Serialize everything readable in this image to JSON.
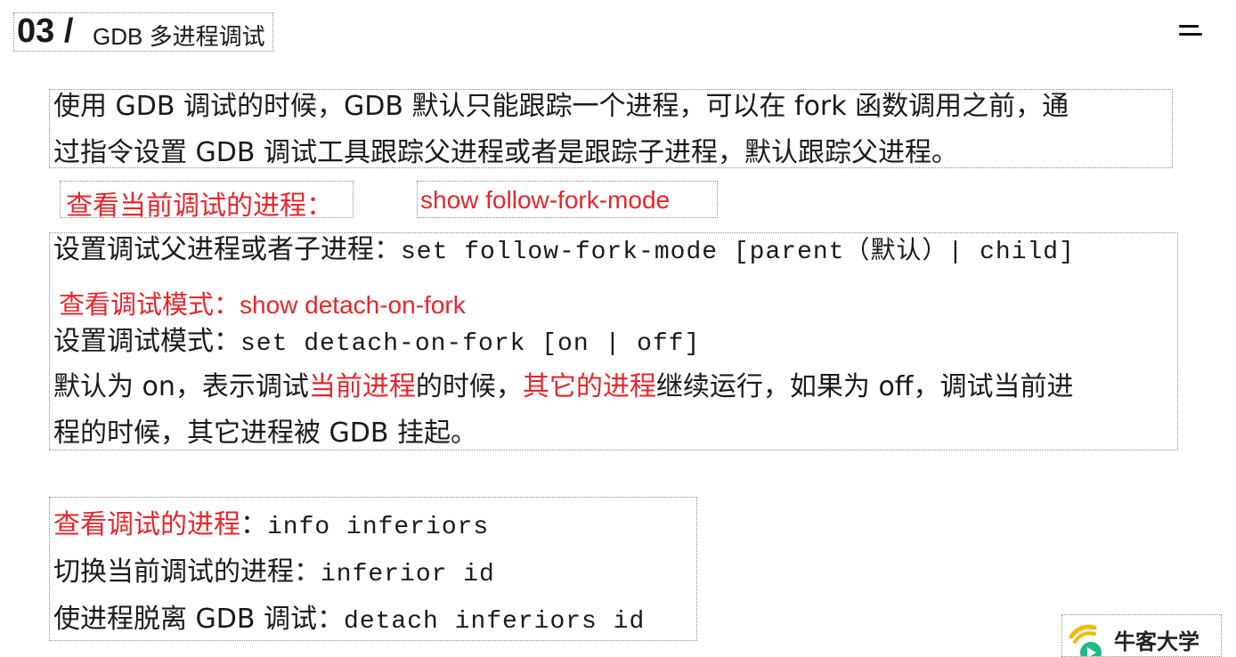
{
  "header": {
    "number": "03 /",
    "title": "GDB 多进程调试"
  },
  "para1": {
    "line1": "使用 GDB 调试的时候，GDB 默认只能跟踪一个进程，可以在 fork 函数调用之前，通",
    "line2": "过指令设置 GDB 调试工具跟踪父进程或者是跟踪子进程，默认跟踪父进程。"
  },
  "view_process": {
    "label": "查看当前调试的进程：",
    "command": "show follow-fork-mode"
  },
  "block2": {
    "set_mode_label": "设置调试父进程或者子进程：",
    "set_mode_cmd": "set follow-fork-mode [parent（默认）| child]",
    "view_mode_label": "查看调试模式：",
    "view_mode_cmd": "show detach-on-fork",
    "set_detach_label": "设置调试模式：",
    "set_detach_cmd": "set detach-on-fork [on | off]",
    "desc_a": "默认为 on，表示调试",
    "desc_b": "当前进程",
    "desc_c": "的时候，",
    "desc_d": "其它的进程",
    "desc_e": "继续运行，如果为 off，调试当前进",
    "desc_line2": "程的时候，其它进程被 GDB 挂起。"
  },
  "block3": {
    "info_label": "查看调试的进程",
    "info_sep": "：",
    "info_cmd": "info inferiors",
    "switch_label": "切换当前调试的进程：",
    "switch_cmd": "inferior id",
    "detach_label": "使进程脱离 GDB 调试：",
    "detach_cmd": "detach inferiors id"
  },
  "logo": {
    "text": "牛客大学",
    "icon": "nowcoder-logo-icon"
  },
  "menu": {
    "icon": "hamburger-menu-icon"
  },
  "colors": {
    "accent_red": "#e8262b",
    "text": "#1a1a1a"
  }
}
